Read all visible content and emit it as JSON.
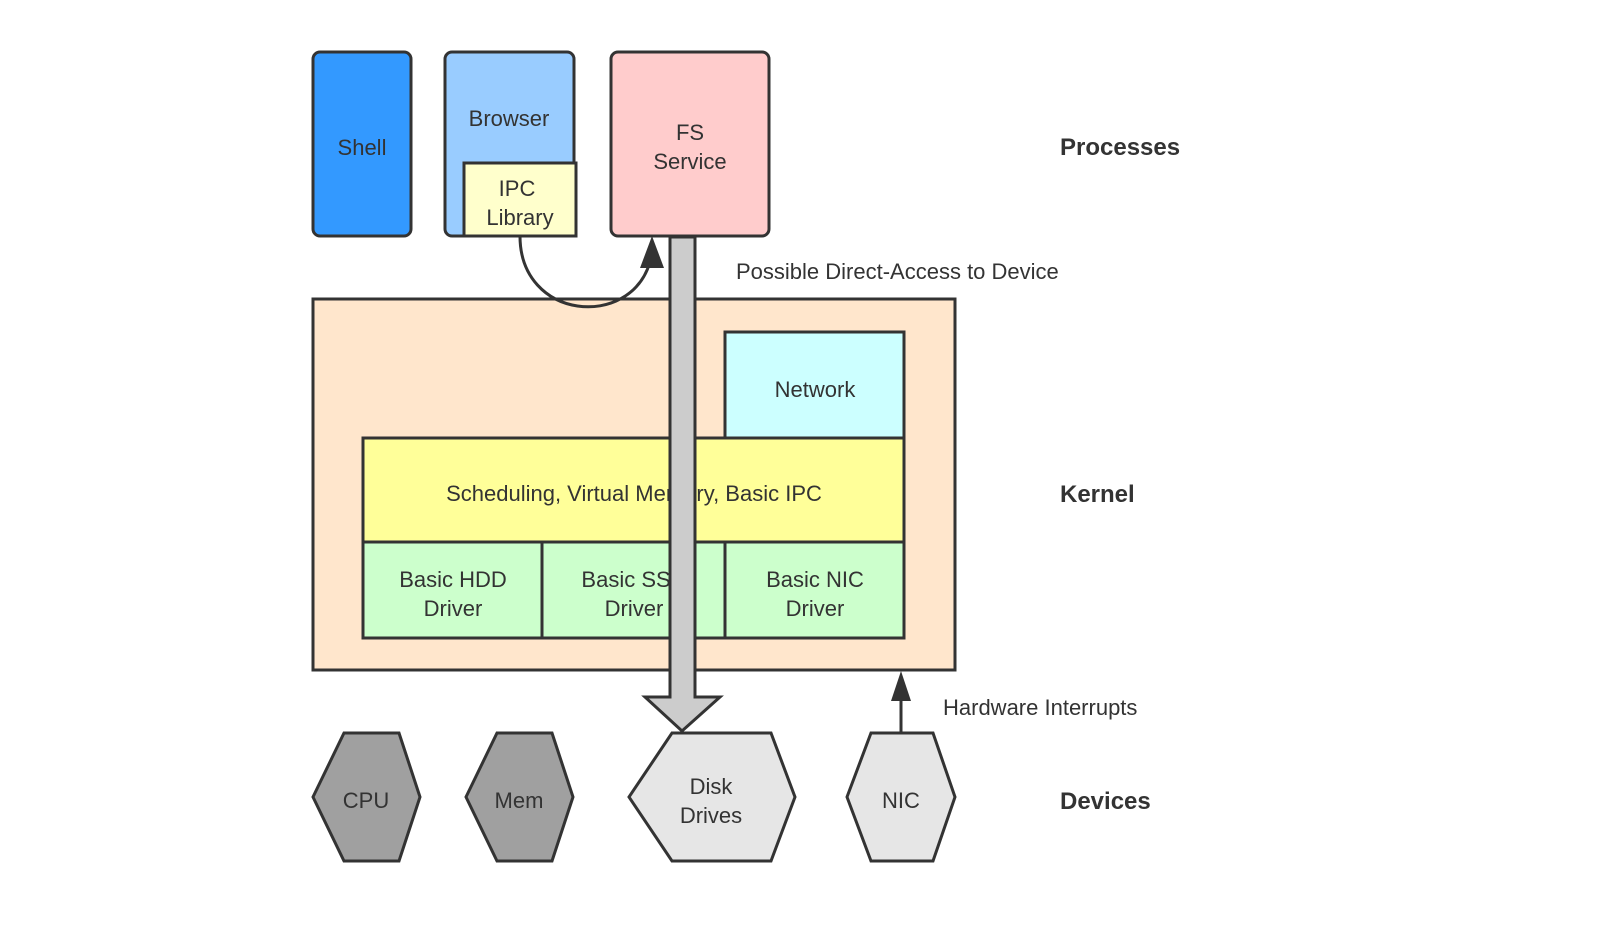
{
  "diagram": {
    "processes": {
      "layer_label": "Processes",
      "shell": {
        "label": "Shell",
        "color": "#3399ff"
      },
      "browser": {
        "label": "Browser",
        "color": "#99ccff"
      },
      "ipc_library": {
        "line1": "IPC",
        "line2": "Library",
        "color": "#ffffcc"
      },
      "fs_service": {
        "line1": "FS",
        "line2": "Service",
        "color": "#ffcccc"
      }
    },
    "kernel": {
      "layer_label": "Kernel",
      "color": "#ffe6cc",
      "network": {
        "label": "Network",
        "color": "#ccffff"
      },
      "core": {
        "label": "Scheduling, Virtual Memory, Basic IPC",
        "color": "#ffff99"
      },
      "drivers": [
        {
          "line1": "Basic HDD",
          "line2": "Driver"
        },
        {
          "line1": "Basic SSD",
          "line2": "Driver"
        },
        {
          "line1": "Basic NIC",
          "line2": "Driver"
        }
      ],
      "driver_color": "#ccffcc"
    },
    "devices": {
      "layer_label": "Devices",
      "items": [
        {
          "line1": "CPU",
          "line2": "",
          "color": "#a0a0a0"
        },
        {
          "line1": "Mem",
          "line2": "",
          "color": "#a0a0a0"
        },
        {
          "line1": "Disk",
          "line2": "Drives",
          "color": "#e6e6e6"
        },
        {
          "line1": "NIC",
          "line2": "",
          "color": "#e6e6e6"
        }
      ]
    },
    "annotations": {
      "direct_access": "Possible Direct-Access to Device",
      "hardware_interrupts": "Hardware Interrupts"
    },
    "colors": {
      "stroke": "#333333",
      "big_arrow": "#cccccc"
    }
  }
}
